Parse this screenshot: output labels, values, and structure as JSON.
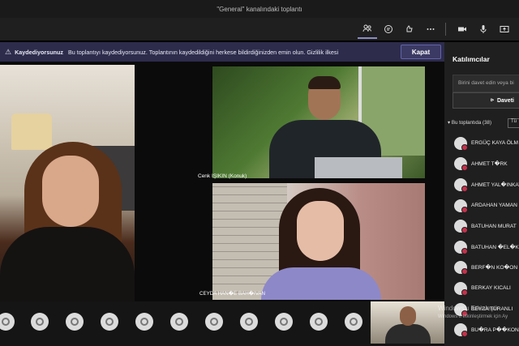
{
  "window": {
    "title": "\"General\" kanalındaki toplantı"
  },
  "toolbar": {
    "icons": [
      "participants-icon",
      "chat-icon",
      "reactions-icon",
      "more-icon",
      "camera-icon",
      "microphone-icon",
      "share-icon"
    ]
  },
  "banner": {
    "title": "Kaydediyorsunuz",
    "message": "Bu toplantıyı kaydediyorsunuz. Toplantının kaydedildiğini herkese bildirdiğinizden emin olun. Gizlilik ilkesi",
    "close_label": "Kapat"
  },
  "stage": {
    "tiles": [
      {
        "label": "Cenk IŞIKIN (Konuk)"
      },
      {
        "label": "CEYDA HAN�E BAH�IVAN"
      }
    ]
  },
  "watermark": {
    "line1": "Windows'u Etkinleştir",
    "line2": "Windows'u etkinleştirmek için Ay"
  },
  "panel": {
    "title": "Katılımcılar",
    "invite_placeholder": "Birini davet edin veya bi",
    "share_label": "Daveti",
    "section_label": "Bu toplantıda (38)",
    "section_button": "Tü",
    "participants": [
      "ERGÜÇ KAYA ÖLM",
      "AHMET T�RK",
      "AHMET YAL�INKAY",
      "ARDAHAN YAMAN",
      "BATUHAN MURAT",
      "BATUHAN �EL�K",
      "BERF�N KO�ON",
      "BERKAY KICALI",
      "BEYZA TURANLI",
      "BU�RA P��KON"
    ]
  }
}
